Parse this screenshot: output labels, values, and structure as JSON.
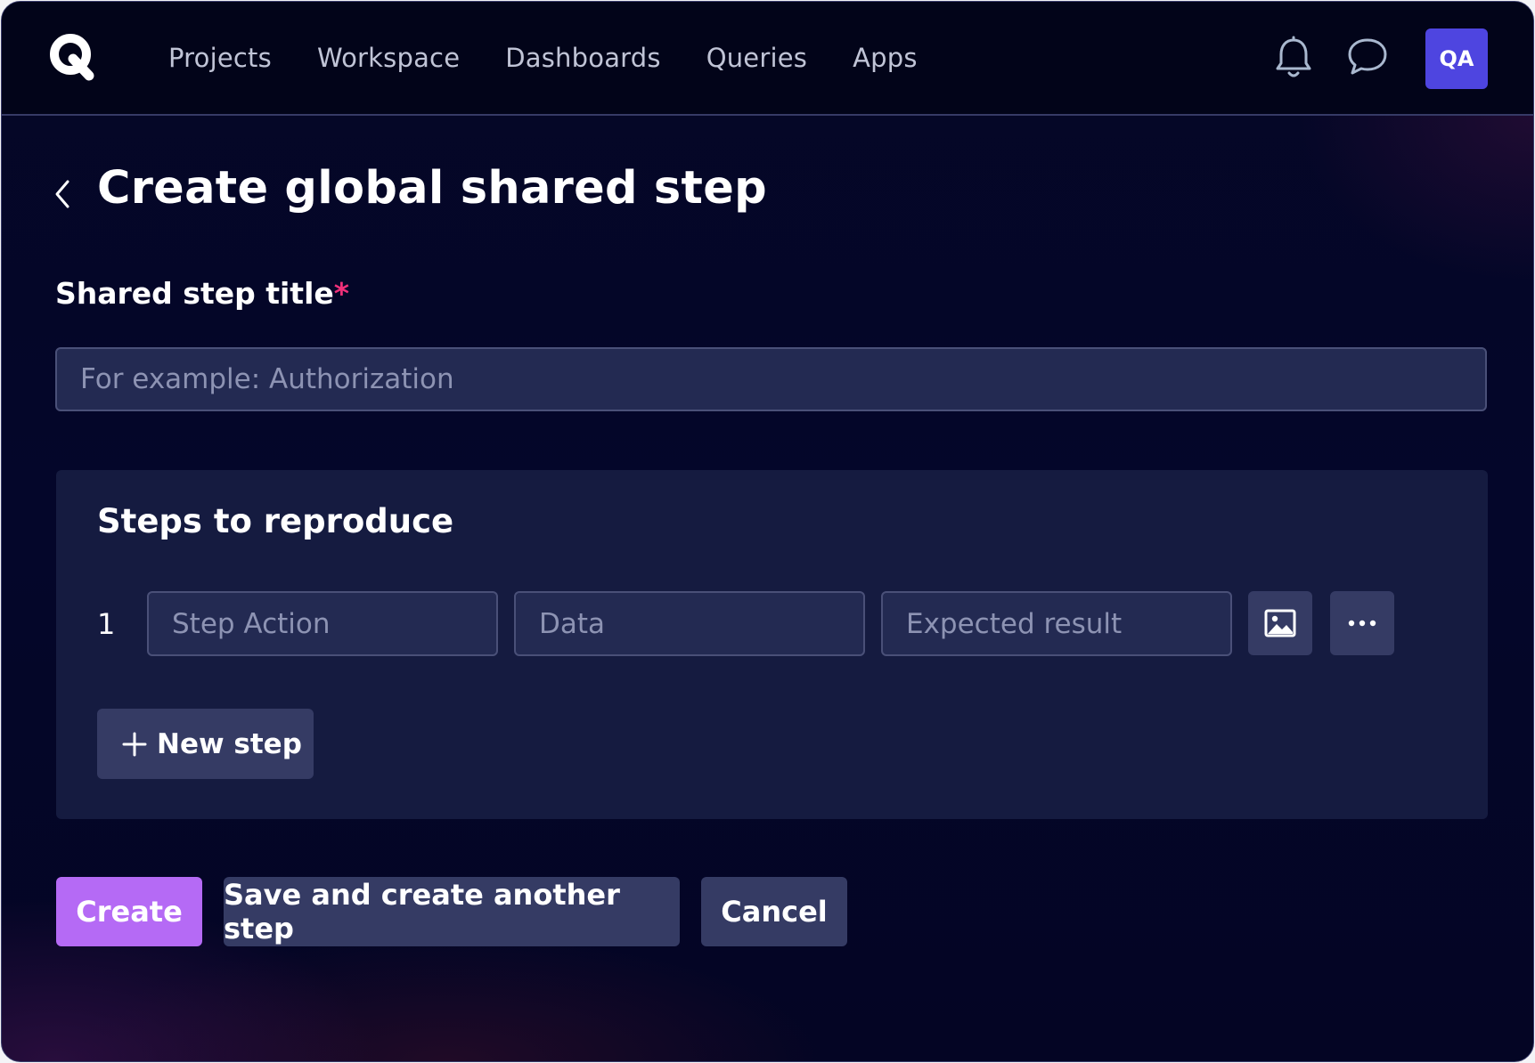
{
  "header": {
    "logo_letter": "Q",
    "nav": [
      {
        "label": "Projects"
      },
      {
        "label": "Workspace"
      },
      {
        "label": "Dashboards"
      },
      {
        "label": "Queries"
      },
      {
        "label": "Apps"
      }
    ],
    "icons": [
      "bell-icon",
      "chat-icon"
    ],
    "avatar_initials": "QA",
    "avatar_color": "#4e45e0"
  },
  "page": {
    "title": "Create global shared step",
    "back_icon": "chevron-left-icon"
  },
  "form": {
    "title_label": "Shared step title",
    "required_mark": "*",
    "title_placeholder": "For example: Authorization",
    "title_value": ""
  },
  "steps": {
    "heading": "Steps to reproduce",
    "rows": [
      {
        "number": "1",
        "action_placeholder": "Step Action",
        "data_placeholder": "Data",
        "expected_placeholder": "Expected result"
      }
    ],
    "row_icons": [
      "image-icon",
      "more-horizontal-icon"
    ],
    "new_step_label": "New step"
  },
  "actions": {
    "create_label": "Create",
    "save_another_label": "Save and create another step",
    "cancel_label": "Cancel"
  },
  "colors": {
    "primary": "#b56af5",
    "required": "#f0307a",
    "surface": "#151b40",
    "secondary_button": "#353b64"
  }
}
